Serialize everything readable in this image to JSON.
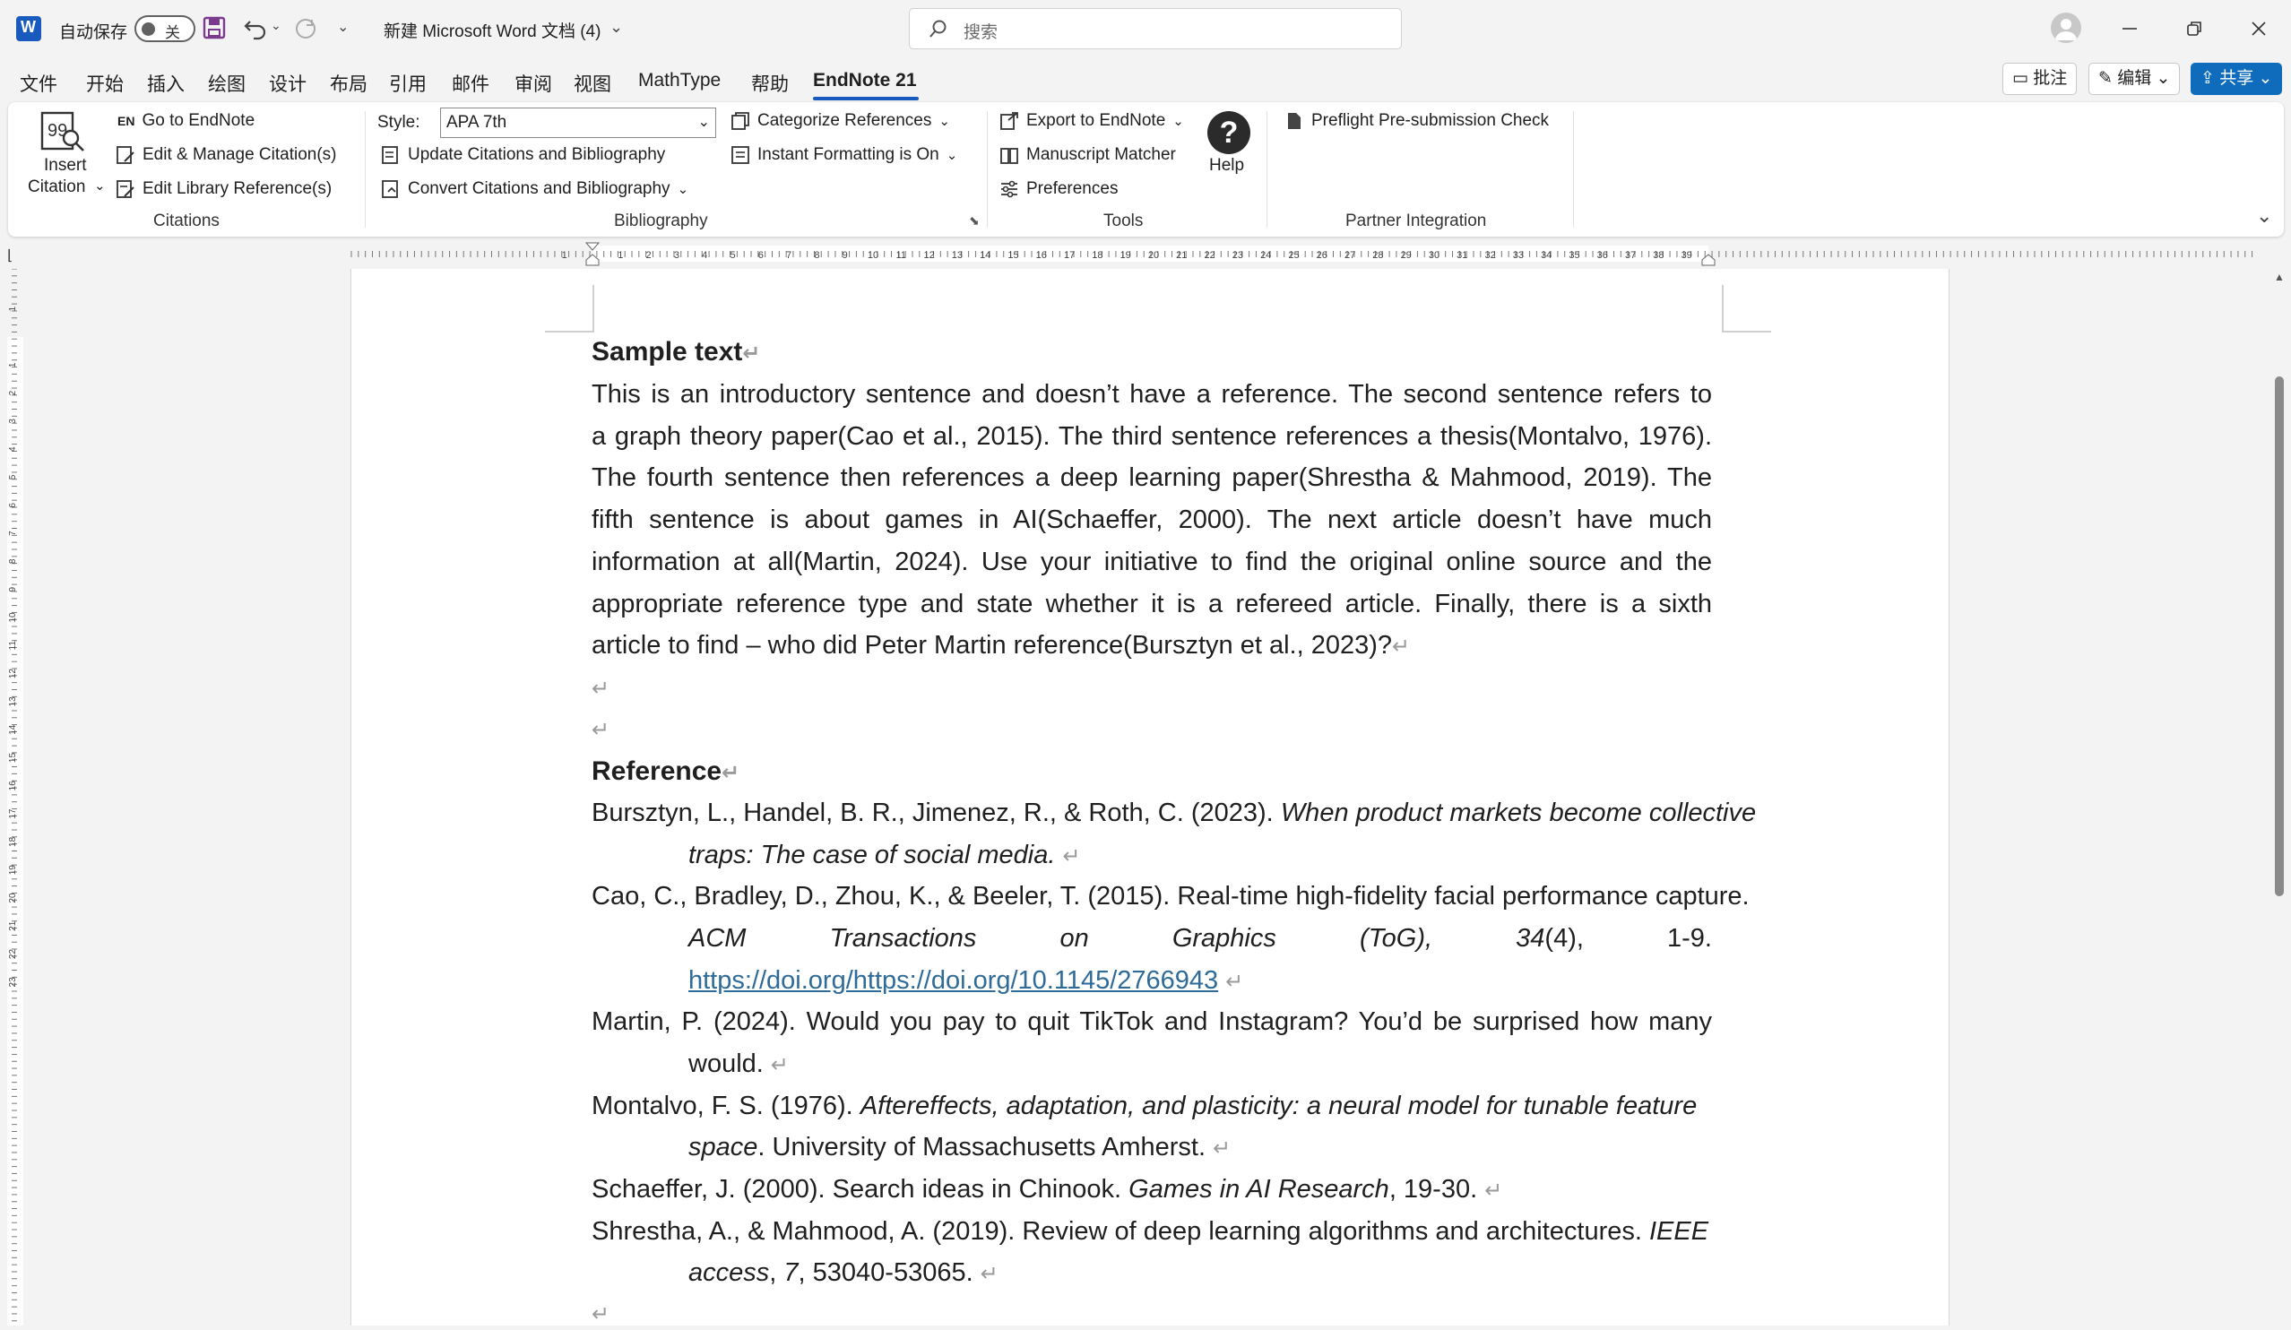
{
  "titlebar": {
    "autosave_label": "自动保存",
    "autosave_state": "关",
    "doc_title": "新建 Microsoft Word 文档 (4)",
    "search_placeholder": "搜索"
  },
  "menu": {
    "tabs": [
      "文件",
      "开始",
      "插入",
      "绘图",
      "设计",
      "布局",
      "引用",
      "邮件",
      "审阅",
      "视图",
      "MathType",
      "帮助",
      "EndNote 21"
    ],
    "active": "EndNote 21",
    "comments": "批注",
    "edit": "编辑",
    "share": "共享"
  },
  "ribbon": {
    "insert_citation": [
      "Insert",
      "Citation"
    ],
    "go_to_endnote": "Go to EndNote",
    "edit_manage": "Edit & Manage Citation(s)",
    "edit_library": "Edit Library Reference(s)",
    "group_citations": "Citations",
    "style_label": "Style:",
    "style_value": "APA 7th",
    "update_citations": "Update Citations and Bibliography",
    "convert_citations": "Convert Citations and Bibliography",
    "categorize": "Categorize References",
    "instant_formatting": "Instant Formatting is On",
    "group_bibliography": "Bibliography",
    "export": "Export to EndNote",
    "manuscript_matcher": "Manuscript Matcher",
    "preferences": "Preferences",
    "help": "Help",
    "group_tools": "Tools",
    "preflight": "Preflight Pre-submission Check",
    "group_partner": "Partner Integration"
  },
  "document": {
    "heading1": "Sample text",
    "paragraph_lines": [
      "This is an introductory sentence and doesn’t have a reference. The second sentence refers to",
      "a graph theory paper(Cao et al., 2015). The third sentence references a thesis(Montalvo, 1976).",
      "The fourth sentence then references a deep learning paper(Shrestha & Mahmood, 2019). The",
      "fifth sentence is about games in AI(Schaeffer, 2000). The next article doesn’t have much",
      "information at all(Martin, 2024). Use your initiative to find the original online source and the",
      "appropriate reference type and state whether it is a refereed article. Finally, there is a sixth",
      "article to find – who did Peter Martin reference(Bursztyn et al., 2023)?"
    ],
    "heading2": "Reference",
    "ref1_a": "Bursztyn, L., Handel, B. R., Jimenez, R., & Roth, C. (2023). ",
    "ref1_b": "When product markets become collective",
    "ref1_c": "traps: The case of social media.",
    "ref2_a": "Cao, C., Bradley, D., Zhou, K., & Beeler, T. (2015). Real-time high-fidelity facial performance capture.",
    "ref2_b": [
      "ACM",
      "Transactions",
      "on",
      "Graphics",
      "(ToG),",
      "34",
      "(4),",
      "1-9."
    ],
    "ref2_link": "https://doi.org/https://doi.org/10.1145/2766943",
    "ref3_a": "Martin, P. (2024). Would you pay to quit TikTok and Instagram? You’d be surprised how many",
    "ref3_b": "would.",
    "ref4_a": "Montalvo, F. S. (1976). ",
    "ref4_b": "Aftereffects, adaptation, and plasticity: a neural model for tunable feature",
    "ref4_c": "space",
    "ref4_d": ". University of Massachusetts Amherst.",
    "ref5_a": "Schaeffer, J. (2000). Search ideas in Chinook. ",
    "ref5_b": "Games in AI Research",
    "ref5_c": ", 19-30.",
    "ref6_a": "Shrestha, A., & Mahmood, A. (2019). Review of deep learning algorithms and architectures. ",
    "ref6_b": "IEEE",
    "ref6_c": "access",
    "ref6_d": ", ",
    "ref6_e": "7",
    "ref6_f": ", 53040-53065.",
    "para_mark": "↵"
  },
  "ruler": {
    "h_numbers": [
      "1",
      "1",
      "2",
      "3",
      "4",
      "5",
      "6",
      "7",
      "8",
      "9",
      "10",
      "11",
      "12",
      "13",
      "14",
      "15",
      "16",
      "17",
      "18",
      "19",
      "20",
      "21",
      "22",
      "23",
      "24",
      "25",
      "26",
      "27",
      "28",
      "29",
      "30",
      "31",
      "32",
      "33",
      "34",
      "35",
      "36",
      "37",
      "38",
      "39"
    ],
    "v_numbers": [
      "1",
      "1",
      "2",
      "3",
      "4",
      "5",
      "6",
      "7",
      "8",
      "9",
      "10",
      "11",
      "12",
      "13",
      "14",
      "15",
      "16",
      "17",
      "18",
      "19",
      "20",
      "21",
      "22",
      "23"
    ]
  },
  "colors": {
    "accent": "#185abd",
    "share_bg": "#0f6cbd",
    "link": "#2e6b98"
  }
}
